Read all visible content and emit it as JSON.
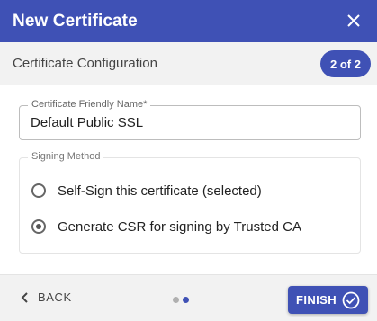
{
  "header": {
    "title": "New Certificate",
    "close_icon": "close-icon"
  },
  "subheader": {
    "title": "Certificate Configuration",
    "step_badge": "2 of 2"
  },
  "form": {
    "friendly_name": {
      "label": "Certificate Friendly Name",
      "required_mark": "*",
      "value": "Default Public SSL"
    },
    "signing_method": {
      "legend": "Signing Method",
      "options": [
        {
          "label": "Self-Sign this certificate (selected)",
          "checked": false
        },
        {
          "label": "Generate CSR for signing by Trusted CA",
          "checked": true
        }
      ]
    }
  },
  "footer": {
    "back_label": "BACK",
    "finish_label": "FINISH",
    "steps_total": 2,
    "current_step": 2
  },
  "colors": {
    "primary": "#3f51b5",
    "header_bg": "#3f51b5",
    "subheader_bg": "#f2f2f2"
  }
}
